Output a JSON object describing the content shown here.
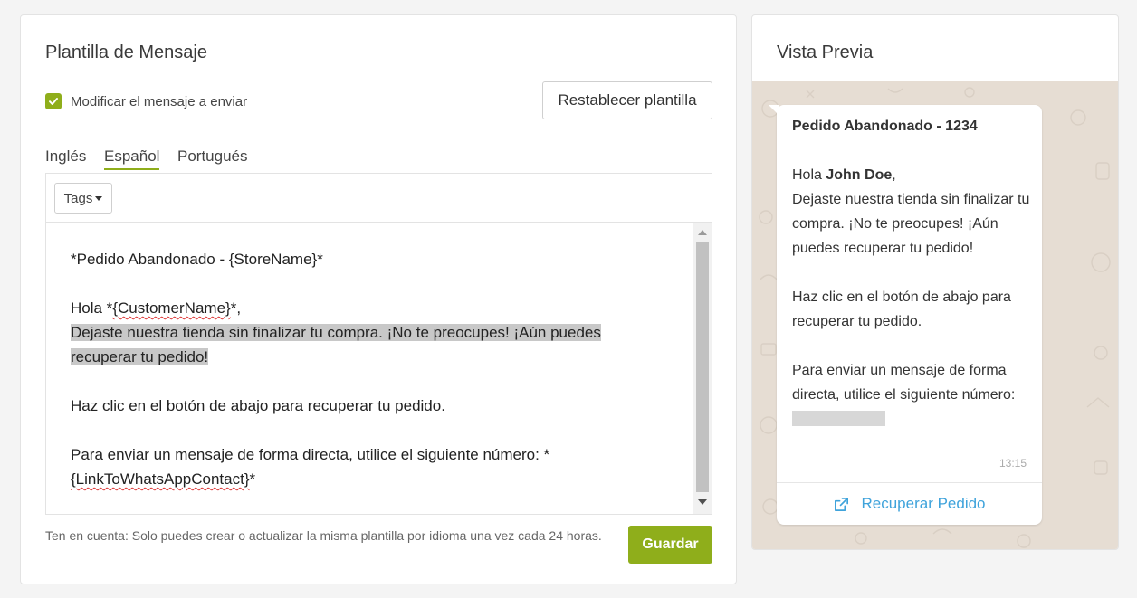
{
  "template": {
    "title": "Plantilla de Mensaje",
    "modify_label": "Modificar el mensaje a enviar",
    "reset_label": "Restablecer plantilla",
    "tabs": [
      "Inglés",
      "Español",
      "Portugués"
    ],
    "active_tab": "Español",
    "tags_label": "Tags",
    "editor": {
      "line1": "*Pedido Abandonado - {StoreName}*",
      "greeting_prefix": "Hola *",
      "customer_tag": "{CustomerName}",
      "greeting_suffix": "*,",
      "highlight_line1": "Dejaste nuestra tienda sin finalizar tu compra. ¡No te preocupes! ¡Aún puedes ",
      "highlight_line2": "recuperar tu pedido!",
      "button_line": "Haz clic en el botón de abajo para recuperar tu pedido.",
      "direct_line": "Para enviar un mensaje de forma directa, utilice el siguiente número: *",
      "link_tag": "{LinkToWhatsAppContact}",
      "link_suffix": "*"
    },
    "note": "Ten en cuenta: Solo puedes crear o actualizar la misma plantilla por idioma una vez cada 24 horas.",
    "save_label": "Guardar"
  },
  "preview": {
    "title": "Vista Previa",
    "bubble": {
      "heading": "Pedido Abandonado - 1234",
      "hola": "Hola ",
      "customer_name": "John Doe",
      "comma": ",",
      "paragraph1": "Dejaste nuestra tienda sin finalizar tu compra. ¡No te preocupes! ¡Aún puedes recuperar tu pedido!",
      "paragraph2": "Haz clic en el botón de abajo para recuperar tu pedido.",
      "paragraph3": "Para enviar un mensaje de forma directa, utilice el siguiente número:",
      "time": "13:15",
      "link_label": "Recuperar Pedido"
    }
  },
  "colors": {
    "accent": "#8fae1b",
    "link": "#3fa3db",
    "chat_background": "#e6ddd3"
  },
  "icons": [
    "checkmark-icon",
    "caret-down-icon",
    "external-link-icon"
  ]
}
